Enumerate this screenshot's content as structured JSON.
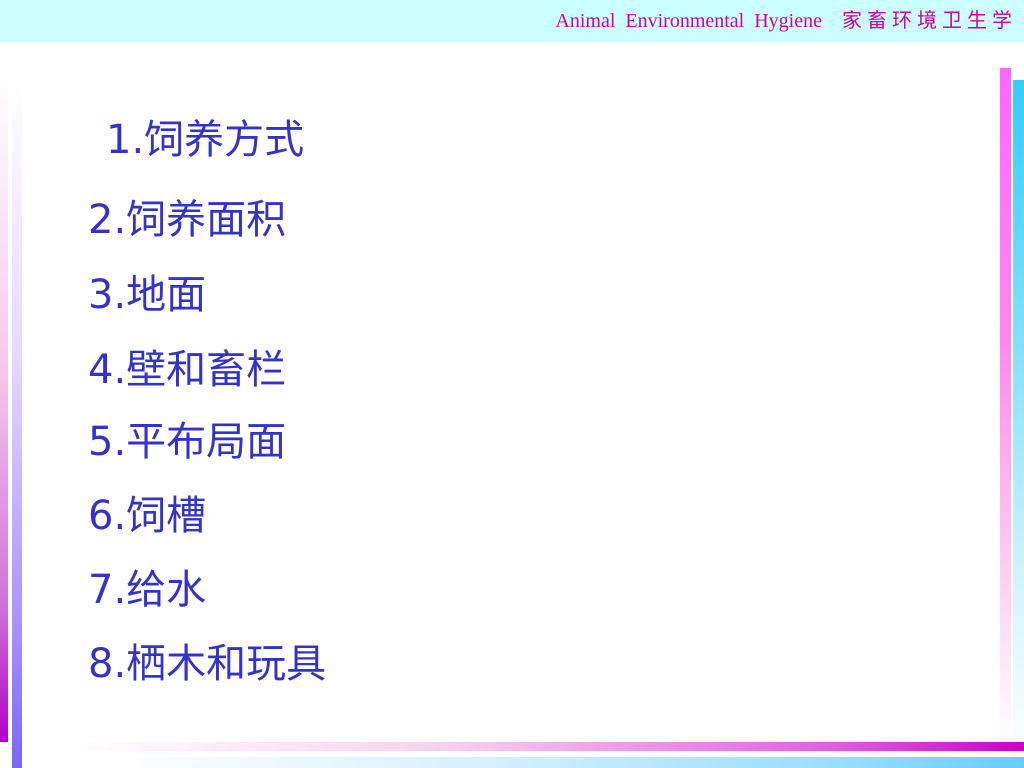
{
  "header": {
    "title": "Animal  Environmental  Hygiene    家 畜 环 境 卫 生 学"
  },
  "items": [
    "1.饲养方式",
    "2.饲养面积",
    "3.地面",
    "4.壁和畜栏",
    "5.平布局面",
    "6.饲槽",
    "7.给水",
    "8.栖木和玩具"
  ],
  "colors": {
    "header_background": "#ccffff",
    "header_text": "#cc00aa",
    "item_text": "#3333cc"
  }
}
